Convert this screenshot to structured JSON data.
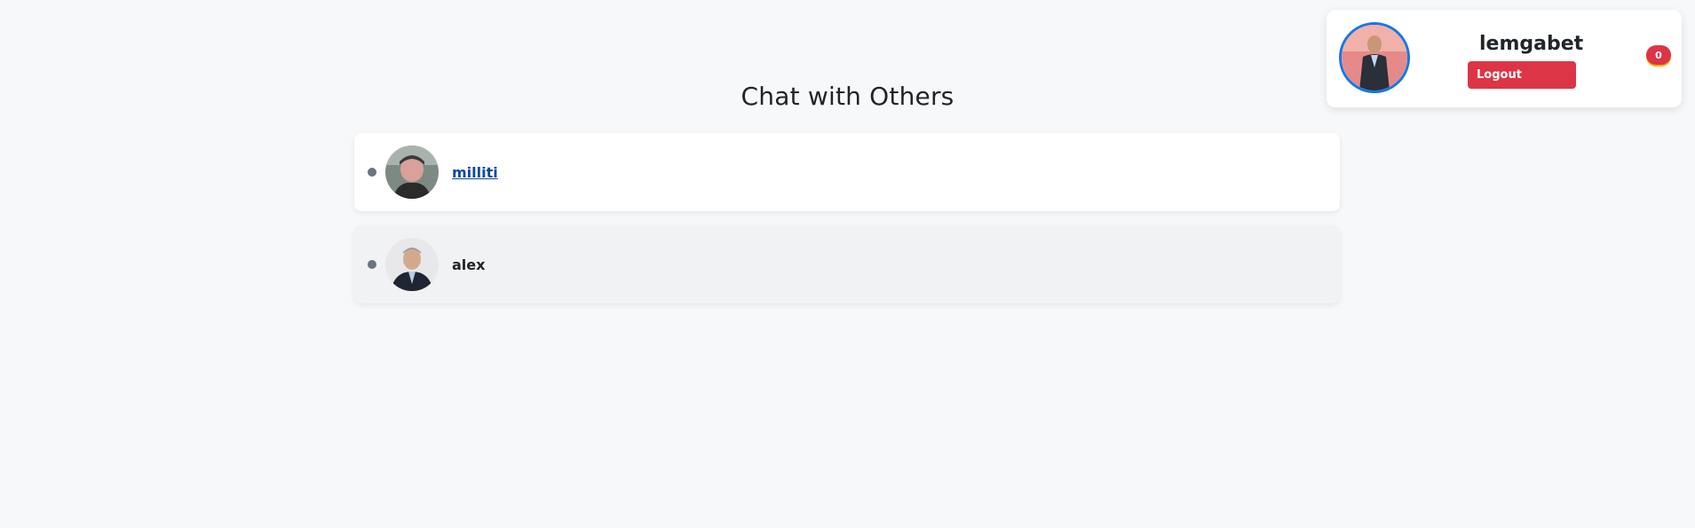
{
  "page": {
    "title": "Chat with Others"
  },
  "chats": [
    {
      "name": "milliti",
      "status": "offline",
      "style": "link"
    },
    {
      "name": "alex",
      "status": "offline",
      "style": "plain"
    }
  ],
  "user": {
    "username": "lemgabet",
    "logout_label": "Logout",
    "notification_count": "0"
  },
  "colors": {
    "background": "#f7f8fa",
    "logout": "#dc3545",
    "avatar_ring": "#1677e5",
    "link": "#0d47a1",
    "status_dot": "#6b7280"
  },
  "icons": {
    "status": "status-dot-icon",
    "notification": "notification-badge"
  }
}
